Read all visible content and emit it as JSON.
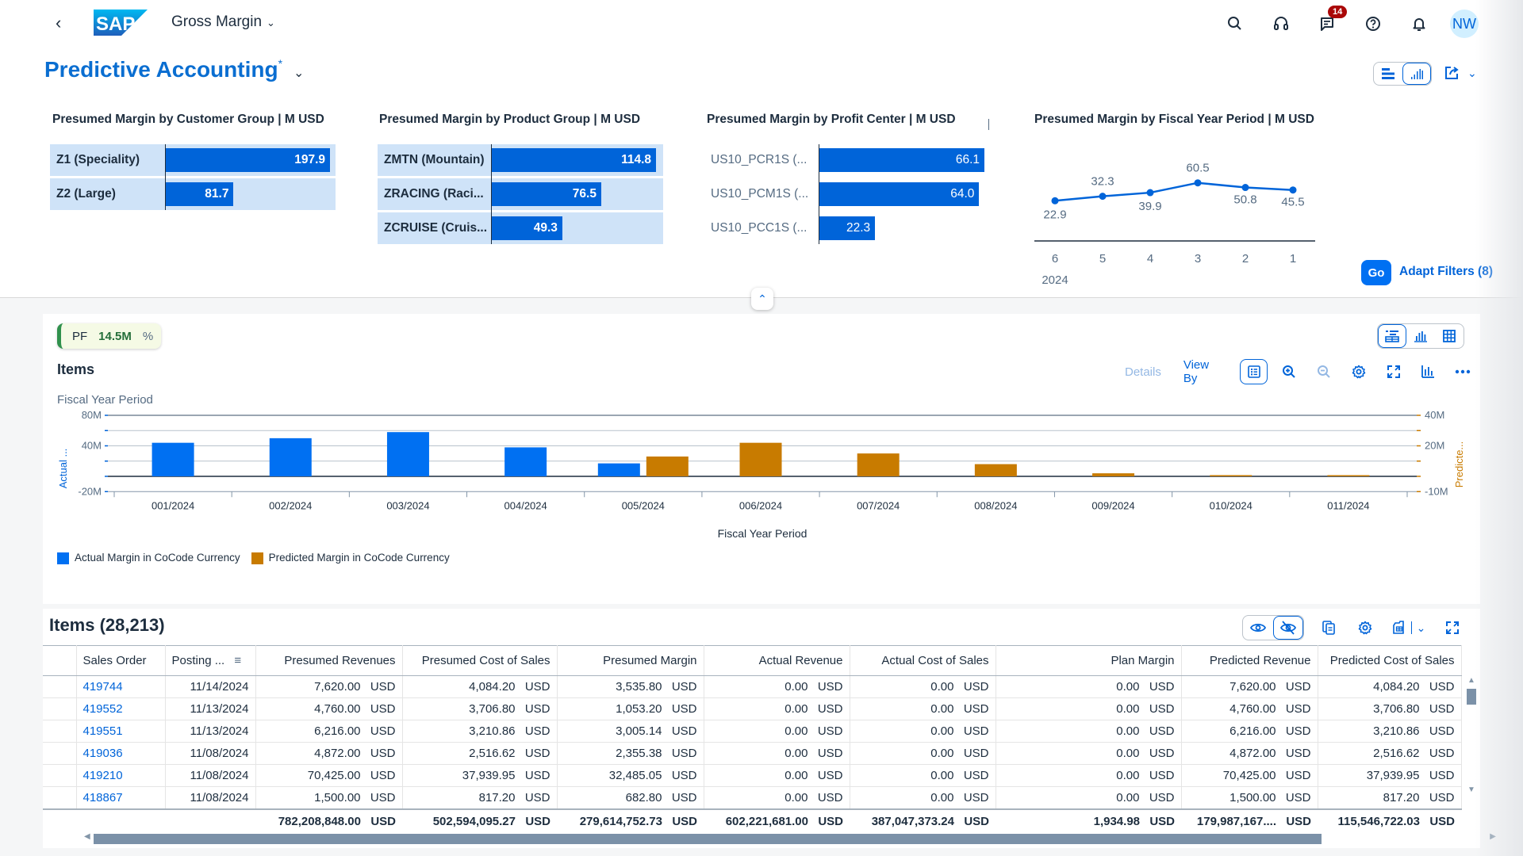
{
  "shell": {
    "app_title": "Gross Margin",
    "logo_text": "SAP",
    "notification_count": "14",
    "avatar_initials": "NW",
    "icons": [
      "back-icon",
      "search-icon",
      "headset-icon",
      "message-icon",
      "help-icon",
      "bell-icon"
    ]
  },
  "header": {
    "page_title": "Predictive Accounting",
    "dirty_marker": "*",
    "go_label": "Go",
    "adapt_filters_label": "Adapt Filters (8)"
  },
  "filter_cards": [
    {
      "title": "Presumed Margin by Customer Group  | M USD",
      "type": "bar",
      "categories": [
        "Z1 (Speciality)",
        "Z2 (Large)"
      ],
      "values": [
        197.9,
        81.7
      ],
      "labels": [
        "197.9",
        "81.7"
      ],
      "selected": true
    },
    {
      "title": "Presumed Margin by Product Group  | M USD",
      "type": "bar",
      "categories": [
        "ZMTN (Mountain)",
        "ZRACING (Raci...",
        "ZCRUISE (Cruis..."
      ],
      "values": [
        114.8,
        76.5,
        49.3
      ],
      "labels": [
        "114.8",
        "76.5",
        "49.3"
      ],
      "selected": true
    },
    {
      "title": "Presumed Margin by Profit Center  | M USD",
      "type": "bar",
      "categories": [
        "US10_PCR1S (...",
        "US10_PCM1S (...",
        "US10_PCC1S (..."
      ],
      "values": [
        66.1,
        64.0,
        22.3
      ],
      "labels": [
        "66.1",
        "64.0",
        "22.3"
      ],
      "selected": false
    },
    {
      "title": "Presumed Margin by Fiscal Year Period  | M USD",
      "type": "line",
      "categories": [
        "6",
        "5",
        "4",
        "3",
        "2",
        "1"
      ],
      "year_label": "2024",
      "values": [
        22.9,
        32.3,
        39.9,
        60.5,
        50.8,
        45.5
      ],
      "labels": [
        "22.9",
        "32.3",
        "39.9",
        "60.5",
        "50.8",
        "45.5"
      ]
    }
  ],
  "chart_panel": {
    "pf_chip": {
      "label": "PF",
      "value": "14.5M",
      "unit": "%"
    },
    "title": "Items",
    "dimension_label": "Fiscal Year Period",
    "toolbar": {
      "details_label": "Details",
      "view_by_label": "View By"
    },
    "colors": {
      "actual": "#0070f2",
      "predicted": "#c87b00"
    }
  },
  "chart_data": {
    "type": "bar",
    "title": "Items",
    "xlabel": "Fiscal Year Period",
    "ylabel": "Actual ...",
    "y2label": "Predicte...",
    "ylim": [
      -20,
      80
    ],
    "y2lim": [
      -10,
      40
    ],
    "yticks": [
      "80M",
      "40M",
      "-20M"
    ],
    "y2ticks": [
      "40M",
      "20M",
      "-10M"
    ],
    "categories": [
      "001/2024",
      "002/2024",
      "003/2024",
      "004/2024",
      "005/2024",
      "006/2024",
      "007/2024",
      "008/2024",
      "009/2024",
      "010/2024",
      "011/2024"
    ],
    "series": [
      {
        "name": "Actual Margin in CoCode Currency",
        "axis": "left",
        "values": [
          44,
          50,
          58,
          38,
          17,
          null,
          null,
          null,
          null,
          null,
          null
        ]
      },
      {
        "name": "Predicted Margin in CoCode Currency",
        "axis": "right",
        "values": [
          null,
          null,
          null,
          null,
          13,
          22,
          15,
          8,
          2,
          0.8,
          0.2
        ]
      }
    ],
    "grid": true,
    "legend": "bottom-left"
  },
  "table": {
    "title": "Items (28,213)",
    "columns": [
      "Sales Order",
      "Posting ...",
      "Presumed Revenues",
      "Presumed Cost of Sales",
      "Presumed Margin",
      "Actual Revenue",
      "Actual Cost of Sales",
      "Plan Margin",
      "Predicted Revenue",
      "Predicted Cost of Sales"
    ],
    "currency": "USD",
    "rows": [
      [
        "419744",
        "11/14/2024",
        "7,620.00",
        "4,084.20",
        "3,535.80",
        "0.00",
        "0.00",
        "0.00",
        "7,620.00",
        "4,084.20"
      ],
      [
        "419552",
        "11/13/2024",
        "4,760.00",
        "3,706.80",
        "1,053.20",
        "0.00",
        "0.00",
        "0.00",
        "4,760.00",
        "3,706.80"
      ],
      [
        "419551",
        "11/13/2024",
        "6,216.00",
        "3,210.86",
        "3,005.14",
        "0.00",
        "0.00",
        "0.00",
        "6,216.00",
        "3,210.86"
      ],
      [
        "419036",
        "11/08/2024",
        "4,872.00",
        "2,516.62",
        "2,355.38",
        "0.00",
        "0.00",
        "0.00",
        "4,872.00",
        "2,516.62"
      ],
      [
        "419210",
        "11/08/2024",
        "70,425.00",
        "37,939.95",
        "32,485.05",
        "0.00",
        "0.00",
        "0.00",
        "70,425.00",
        "37,939.95"
      ],
      [
        "418867",
        "11/08/2024",
        "1,500.00",
        "817.20",
        "682.80",
        "0.00",
        "0.00",
        "0.00",
        "1,500.00",
        "817.20"
      ]
    ],
    "totals": [
      "",
      "",
      "782,208,848.00",
      "502,594,095.27",
      "279,614,752.73",
      "602,221,681.00",
      "387,047,373.24",
      "1,934.98",
      "179,987,167....",
      "115,546,722.03"
    ]
  }
}
